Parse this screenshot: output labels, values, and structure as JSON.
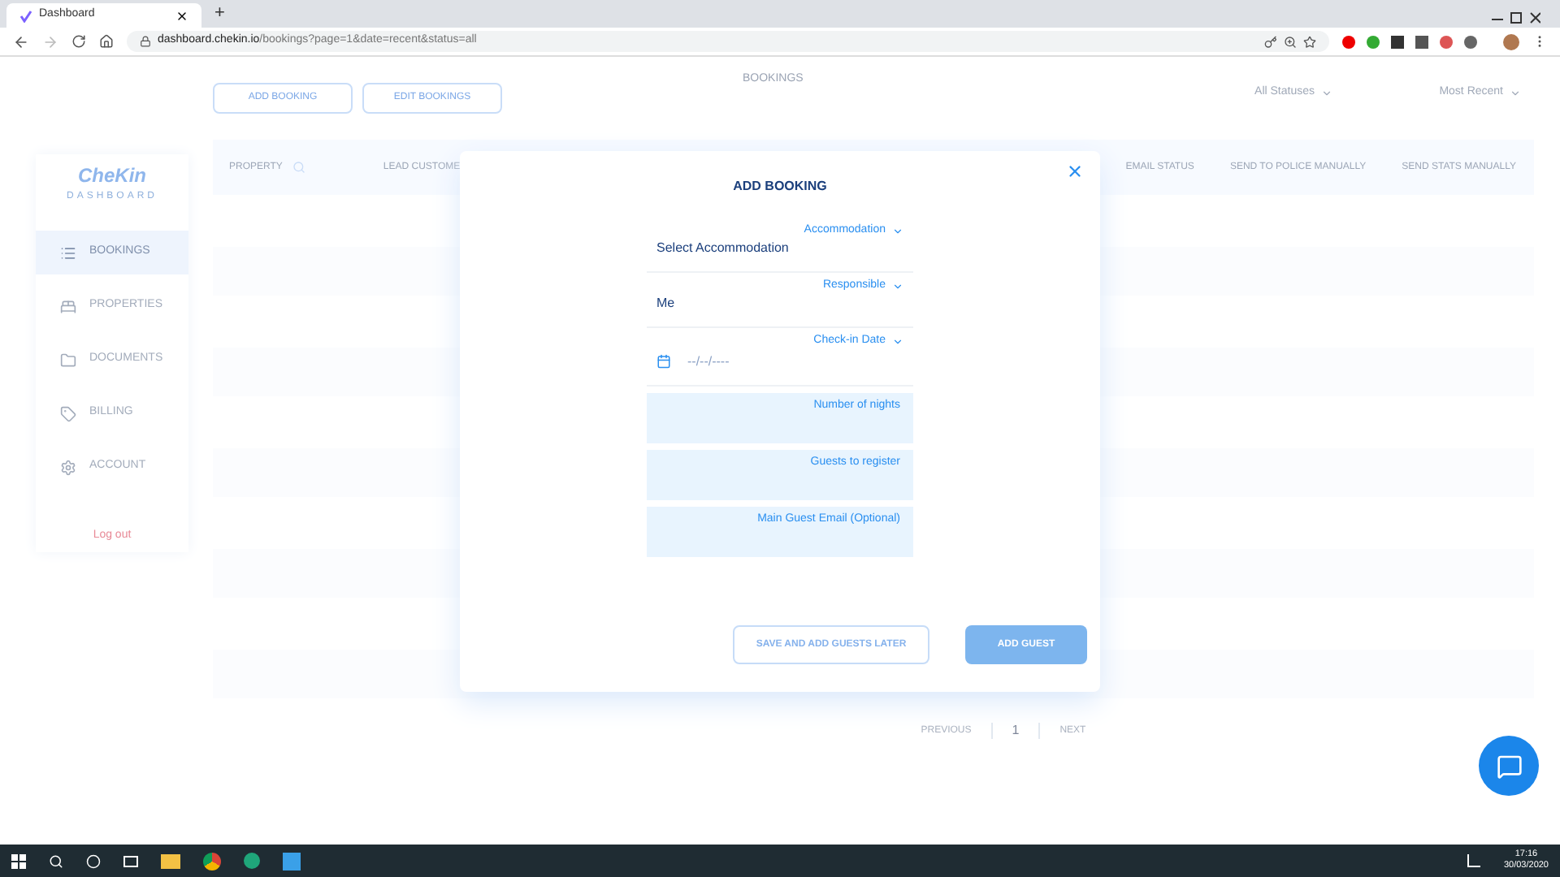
{
  "browser": {
    "tab_title": "Dashboard",
    "new_tab": "+",
    "url_host": "dashboard.chekin.io",
    "url_path": "/bookings?page=1&date=recent&status=all"
  },
  "sidebar": {
    "logo": "CheKin",
    "logo_subtitle": "DASHBOARD",
    "items": [
      {
        "label": "BOOKINGS",
        "selected": true
      },
      {
        "label": "PROPERTIES",
        "selected": false
      },
      {
        "label": "DOCUMENTS",
        "selected": false
      },
      {
        "label": "BILLING",
        "selected": false
      },
      {
        "label": "ACCOUNT",
        "selected": false
      }
    ],
    "logout": "Log out"
  },
  "toolbar": {
    "buttons": [
      "ADD BOOKING",
      "EDIT BOOKINGS"
    ],
    "title": "BOOKINGS",
    "filters": [
      "All Statuses",
      "Most Recent"
    ]
  },
  "table": {
    "columns": [
      "PROPERTY",
      "LEAD CUSTOME",
      "EMAIL STATUS",
      "SEND TO POLICE MANUALLY",
      "SEND STATS MANUALLY"
    ]
  },
  "pagination": {
    "previous": "PREVIOUS",
    "page": "1",
    "next": "NEXT"
  },
  "modal": {
    "title": "ADD BOOKING",
    "fields": [
      {
        "kind": "select",
        "label": "Accommodation",
        "value": "Select Accommodation"
      },
      {
        "kind": "select",
        "label": "Responsible",
        "value": "Me"
      },
      {
        "kind": "date",
        "label": "Check-in Date",
        "value": "--/--/----"
      },
      {
        "kind": "input",
        "label": "Number of nights"
      },
      {
        "kind": "input",
        "label": "Guests to register"
      },
      {
        "kind": "input",
        "label": "Main Guest Email (Optional)"
      }
    ],
    "secondary_button": "SAVE AND ADD GUESTS LATER",
    "primary_button": "ADD GUEST"
  },
  "taskbar": {
    "time": "17:16",
    "date": "30/03/2020"
  }
}
